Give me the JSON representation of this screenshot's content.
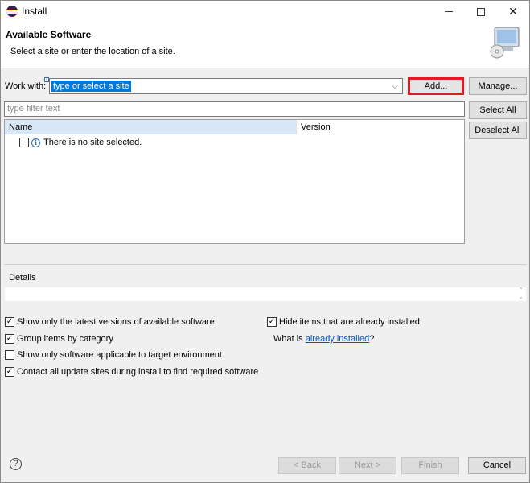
{
  "window": {
    "title": "Install",
    "header_title": "Available Software",
    "header_description": "Select a site or enter the location of a site."
  },
  "work_with": {
    "label": "Work with:",
    "combo_value": "type or select a site",
    "add_button": "Add...",
    "manage_button": "Manage..."
  },
  "filter": {
    "placeholder": "type filter text"
  },
  "table": {
    "columns": [
      "Name",
      "Version"
    ],
    "rows": [
      {
        "name": "There is no site selected.",
        "version": ""
      }
    ]
  },
  "side_buttons": {
    "select_all": "Select All",
    "deselect_all": "Deselect All"
  },
  "details": {
    "label": "Details"
  },
  "options": {
    "latest_versions": {
      "label": "Show only the latest versions of available software",
      "checked": true
    },
    "group_by_category": {
      "label": "Group items by category",
      "checked": true
    },
    "applicable_to_target": {
      "label": "Show only software applicable to target environment",
      "checked": false
    },
    "contact_all_sites": {
      "label": "Contact all update sites during install to find required software",
      "checked": true
    },
    "hide_installed": {
      "label": "Hide items that are already installed",
      "checked": true
    },
    "what_is_prefix": "What is ",
    "what_is_link": "already installed",
    "what_is_suffix": "?"
  },
  "footer": {
    "back": "< Back",
    "next": "Next >",
    "finish": "Finish",
    "cancel": "Cancel"
  },
  "colors": {
    "highlight_border": "#e01b22",
    "selection_bg": "#0078d7",
    "header_column_bg": "#d9e8f7",
    "link": "#0055cc"
  }
}
